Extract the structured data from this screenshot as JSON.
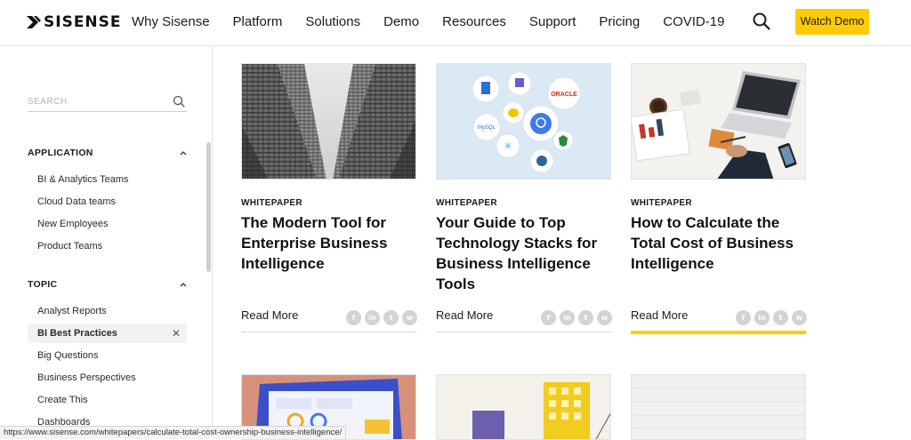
{
  "header": {
    "logo_text": "SISENSE",
    "nav": [
      "Why Sisense",
      "Platform",
      "Solutions",
      "Demo",
      "Resources",
      "Support",
      "Pricing",
      "COVID-19"
    ],
    "cta_label": "Watch Demo"
  },
  "sidebar": {
    "search_placeholder": "SEARCH",
    "sections": [
      {
        "title": "APPLICATION",
        "items": [
          "BI & Analytics Teams",
          "Cloud Data teams",
          "New Employees",
          "Product Teams"
        ]
      },
      {
        "title": "TOPIC",
        "items": [
          "Analyst Reports",
          "BI Best Practices",
          "Big Questions",
          "Business Perspectives",
          "Create This",
          "Dashboards"
        ],
        "selected": "BI Best Practices"
      }
    ]
  },
  "cards": [
    {
      "type": "WHITEPAPER",
      "title": "The Modern Tool for Enterprise Business Intelligence",
      "read_more": "Read More",
      "image": "glass-skyscrapers-photo",
      "active": false
    },
    {
      "type": "WHITEPAPER",
      "title": "Your Guide to Top Technology Stacks for Business Intelligence Tools",
      "read_more": "Read More",
      "image": "tech-stack-logos-illustration",
      "logo_labels": [
        "ORACLE",
        "MySQL"
      ],
      "active": false
    },
    {
      "type": "WHITEPAPER",
      "title": "How to Calculate the Total Cost of Business Intelligence",
      "read_more": "Read More",
      "image": "desk-laptop-calculator-photo",
      "active": true
    }
  ],
  "social_icons": [
    "facebook-icon",
    "linkedin-icon",
    "twitter-icon",
    "whatsapp-icon"
  ],
  "social_glyphs": [
    "f",
    "in",
    "t",
    "w"
  ],
  "colors": {
    "accent": "#ffcb05",
    "social": "#d3d3d3",
    "image2_bg": "#dbe9f5"
  },
  "status_url": "https://www.sisense.com/whitepapers/calculate-total-cost-ownership-business-intelligence/"
}
